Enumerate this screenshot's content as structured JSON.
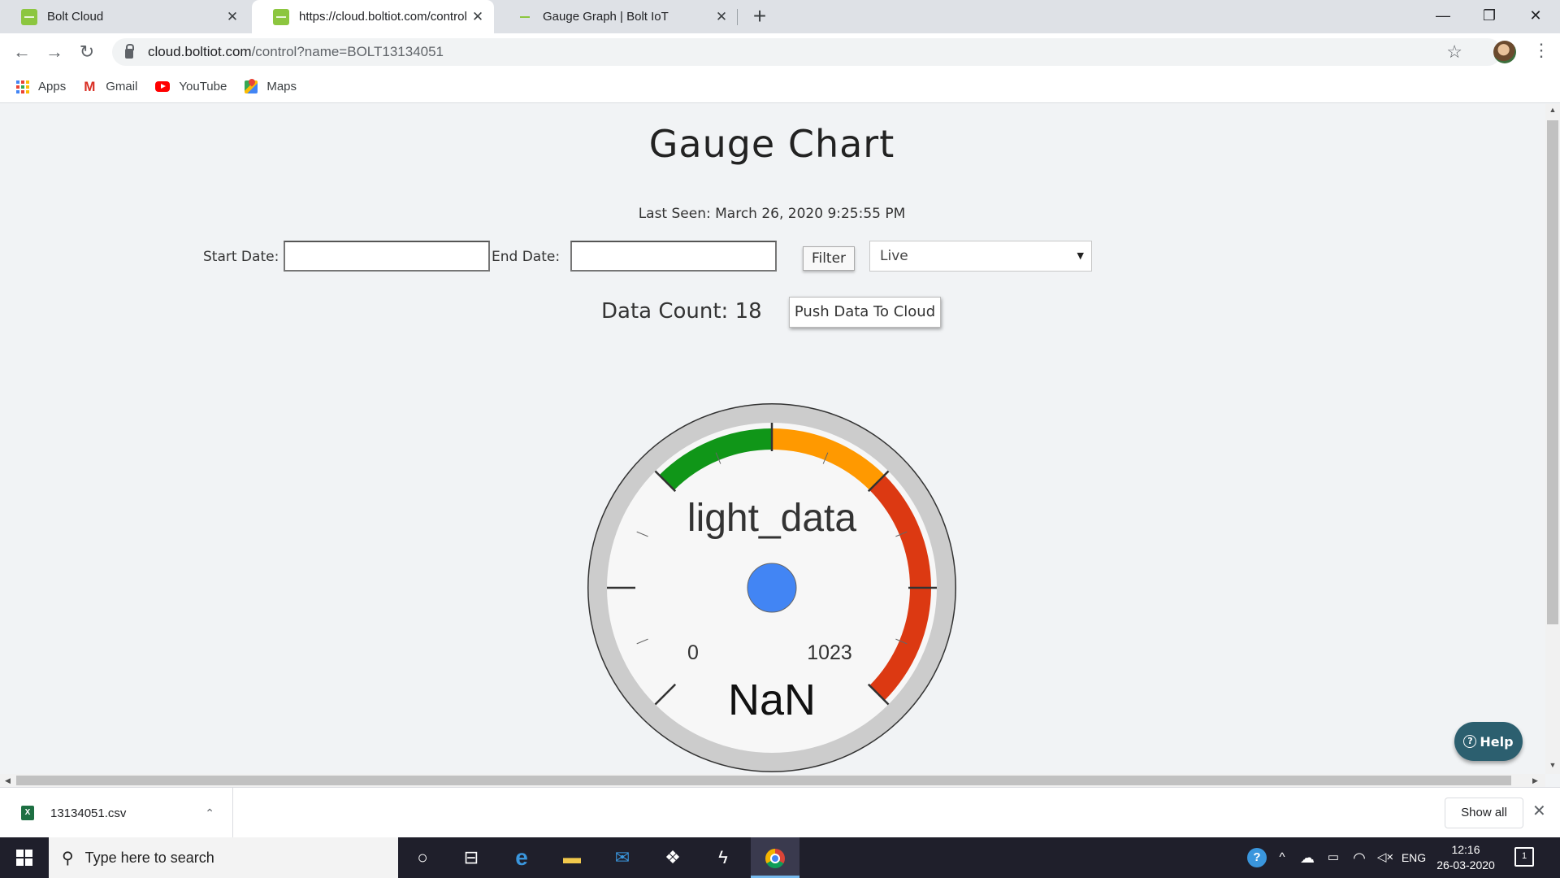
{
  "browser": {
    "tabs": [
      {
        "title": "Bolt Cloud"
      },
      {
        "title": "https://cloud.boltiot.com/control"
      },
      {
        "title": "Gauge Graph | Bolt IoT"
      }
    ],
    "tab_close": "✕",
    "new_tab": "+",
    "window": {
      "minimize": "—",
      "maximize": "❐",
      "close": "✕"
    },
    "nav": {
      "back": "←",
      "forward": "→",
      "reload": "↻"
    },
    "url_domain": "cloud.boltiot.com",
    "url_path": "/control?name=BOLT13134051",
    "star": "☆",
    "menu": "⋮",
    "bookmarks": [
      {
        "label": "Apps",
        "icon": "apps-grid-icon"
      },
      {
        "label": "Gmail",
        "icon": "gmail-icon"
      },
      {
        "label": "YouTube",
        "icon": "youtube-icon"
      },
      {
        "label": "Maps",
        "icon": "maps-icon"
      }
    ]
  },
  "page": {
    "title": "Gauge Chart",
    "last_seen": "Last Seen: March 26, 2020 9:25:55 PM",
    "start_label": "Start Date:",
    "end_label": "End Date:",
    "start_value": "",
    "end_value": "",
    "filter_label": "Filter",
    "select_value": "Live",
    "data_count": "Data Count: 18",
    "push_label": "Push Data To Cloud",
    "help_label": "Help",
    "help_q": "?"
  },
  "gauge": {
    "label": "light_data",
    "value_text": "NaN",
    "min_label": "0",
    "max_label": "1023",
    "min": 0,
    "max": 1023,
    "bands": [
      {
        "from": 0.333,
        "to": 0.5,
        "color": "#109618"
      },
      {
        "from": 0.5,
        "to": 0.667,
        "color": "#ff9900"
      },
      {
        "from": 0.667,
        "to": 1.0,
        "color": "#dc3912"
      }
    ],
    "center_color": "#4285f4"
  },
  "downloads": {
    "file": "13134051.csv",
    "caret": "⌃",
    "show_all": "Show all",
    "close": "✕"
  },
  "taskbar": {
    "search_placeholder": "Type here to search",
    "search_icon": "⚲",
    "cortana": "○",
    "taskview": "⊟",
    "edge": "e",
    "explorer": "▬",
    "mail": "✉",
    "dropbox": "❖",
    "app": "ϟ",
    "tray_help": "?",
    "tray_chevron": "^",
    "tray_cloud": "☁",
    "tray_battery": "▭",
    "tray_wifi": "◠",
    "tray_volume": "◁×",
    "lang": "ENG",
    "time": "12:16",
    "date": "26-03-2020",
    "notifications": "1"
  }
}
